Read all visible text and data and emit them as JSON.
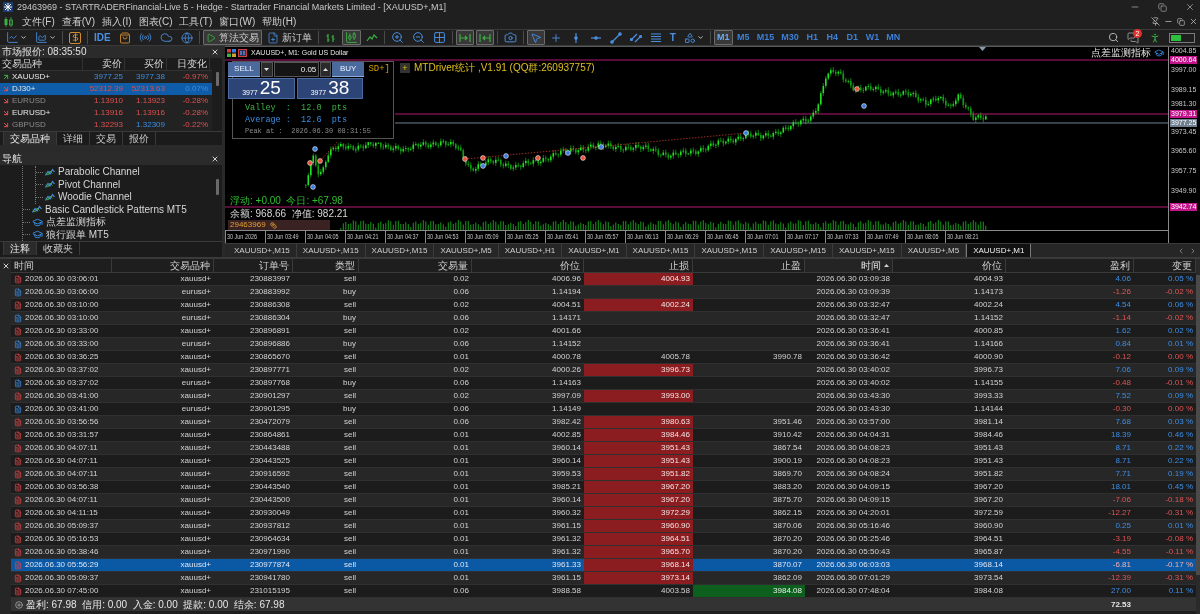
{
  "window": {
    "title": "29463969 - STARTRADERFinancial-Live 5 - Hedge - Startrader Financial Markets Limited - [XAUUSD+,M1]"
  },
  "menu": [
    "文件(F)",
    "查看(V)",
    "插入(I)",
    "图表(C)",
    "工具(T)",
    "窗口(W)",
    "帮助(H)"
  ],
  "toolbar": {
    "groups": [
      [
        {
          "kind": "indicators",
          "pressed": false
        },
        {
          "kind": "templates",
          "pressed": false
        }
      ],
      [
        {
          "kind": "dollar",
          "pressed": false
        }
      ],
      [
        {
          "kind": "ide",
          "label": "IDE",
          "pressed": false
        },
        {
          "kind": "market",
          "pressed": false
        },
        {
          "kind": "signals",
          "pressed": false
        },
        {
          "kind": "cloud",
          "pressed": false
        },
        {
          "kind": "vps",
          "pressed": false
        }
      ],
      [
        {
          "kind": "algo-trading",
          "label": "算法交易",
          "pressed": true
        },
        {
          "kind": "new-order",
          "label": "新订单",
          "pressed": false
        }
      ],
      [
        {
          "kind": "bar-chart",
          "pressed": false
        },
        {
          "kind": "candlestick-chart",
          "pressed": true
        },
        {
          "kind": "line-chart",
          "pressed": false
        }
      ],
      [
        {
          "kind": "zoom-in",
          "pressed": false
        },
        {
          "kind": "zoom-out",
          "pressed": false
        },
        {
          "kind": "tile",
          "pressed": false
        }
      ],
      [
        {
          "kind": "auto-scroll",
          "pressed": true
        },
        {
          "kind": "chart-shift",
          "pressed": true
        }
      ],
      [
        {
          "kind": "screenshot",
          "pressed": false
        }
      ],
      [
        {
          "kind": "cursor",
          "pressed": true
        },
        {
          "kind": "crosshair",
          "pressed": false
        },
        {
          "kind": "vertical-line",
          "pressed": false
        },
        {
          "kind": "horizontal-line",
          "pressed": false
        },
        {
          "kind": "trend-line",
          "pressed": false
        },
        {
          "kind": "channel",
          "pressed": false
        },
        {
          "kind": "fibonacci",
          "pressed": false
        },
        {
          "kind": "text-tool",
          "label": "T",
          "pressed": false
        },
        {
          "kind": "shapes",
          "pressed": false
        }
      ]
    ],
    "timeframes": [
      {
        "label": "M1",
        "selected": true
      },
      {
        "label": "M5",
        "selected": false
      },
      {
        "label": "M15",
        "selected": false
      },
      {
        "label": "M30",
        "selected": false
      },
      {
        "label": "H1",
        "selected": false
      },
      {
        "label": "H4",
        "selected": false
      },
      {
        "label": "D1",
        "selected": false
      },
      {
        "label": "W1",
        "selected": false
      },
      {
        "label": "MN",
        "selected": false
      }
    ],
    "notifications": "2"
  },
  "market_watch": {
    "title": "市场报价: 08:35:50",
    "columns": [
      "交易品种",
      "卖价",
      "买价",
      "日变化"
    ],
    "rows": [
      {
        "symbol": "XAUUSD+",
        "bid": "3977.25",
        "ask": "3977.38",
        "change": "-0.97%",
        "rising": true,
        "bid_up": true,
        "ask_up": true,
        "change_up": false,
        "selected": false,
        "dimmed": false
      },
      {
        "symbol": "DJ30+",
        "bid": "52312.39",
        "ask": "52313.63",
        "change": "0.07%",
        "rising": false,
        "bid_up": false,
        "ask_up": false,
        "change_up": true,
        "selected": true,
        "dimmed": false
      },
      {
        "symbol": "EURUSD",
        "bid": "1.13910",
        "ask": "1.13923",
        "change": "-0.28%",
        "rising": false,
        "bid_up": false,
        "ask_up": false,
        "change_up": false,
        "selected": false,
        "dimmed": true
      },
      {
        "symbol": "EURUSD+",
        "bid": "1.13916",
        "ask": "1.13916",
        "change": "-0.28%",
        "rising": false,
        "bid_up": false,
        "ask_up": false,
        "change_up": false,
        "selected": false,
        "dimmed": false
      },
      {
        "symbol": "GBPUSD",
        "bid": "1.32293",
        "ask": "1.32309",
        "change": "-0.22%",
        "rising": false,
        "bid_up": false,
        "ask_up": true,
        "change_up": false,
        "selected": false,
        "dimmed": true
      }
    ],
    "tabs": [
      {
        "label": "交易品种",
        "selected": true
      },
      {
        "label": "详细",
        "selected": false
      },
      {
        "label": "交易",
        "selected": false
      },
      {
        "label": "报价",
        "selected": false
      }
    ]
  },
  "navigator": {
    "title": "导航",
    "items": [
      {
        "children": [
          {
            "label": "Parabolic Channel",
            "kind": "indicator"
          },
          {
            "label": "Pivot Channel",
            "kind": "indicator"
          },
          {
            "label": "Woodie Channel",
            "kind": "indicator"
          }
        ]
      },
      {
        "label": "Basic Candlestick Patterns MT5",
        "kind": "indicator"
      },
      {
        "label": "点差监测指标",
        "kind": "expert"
      },
      {
        "label": "狼行跟单 MT5",
        "kind": "expert"
      }
    ],
    "tabs": [
      {
        "label": "注释",
        "selected": true
      },
      {
        "label": "收藏夹",
        "selected": false
      }
    ]
  },
  "chart": {
    "title": "XAUUSD+, M1: Gold US Dollar",
    "trade_panel": {
      "sell": {
        "label": "SELL",
        "price_main": "3977",
        "price_pips": "25"
      },
      "buy": {
        "label": "BUY",
        "price_main": "3977",
        "price_pips": "38"
      },
      "volume": "0.05"
    },
    "stats": {
      "title": "SD+]",
      "lines": [
        {
          "kind": "valley",
          "text": "Valley  :  12.0  pts"
        },
        {
          "kind": "average",
          "text": "Average :  12.6  pts"
        },
        {
          "kind": "peak",
          "text": "Peak at :  2026.06.30 08:31:55"
        }
      ]
    },
    "indicator": {
      "button": "+",
      "label": "MTDriver统计 ,V1.91 (QQ群:260937757)"
    },
    "corner_label": "点差监测指标",
    "account": {
      "lines": [
        {
          "kind": "floating",
          "text": "浮动: +0.00  今日: +67.98"
        },
        {
          "kind": "balance",
          "text": "余额: 968.66  净值: 982.21"
        }
      ],
      "badge": "29463969"
    },
    "price_axis": [
      {
        "label": "4004.85",
        "kind": "tick"
      },
      {
        "label": "4000.64",
        "kind": "level"
      },
      {
        "label": "3997.00",
        "kind": "tick"
      },
      {
        "label": "3989.15",
        "kind": "tick"
      },
      {
        "label": "3981.30",
        "kind": "tick"
      },
      {
        "label": "3979.31",
        "kind": "level"
      },
      {
        "label": "3977.25",
        "kind": "bid"
      },
      {
        "label": "3973.45",
        "kind": "tick"
      },
      {
        "label": "3965.60",
        "kind": "tick"
      },
      {
        "label": "3957.75",
        "kind": "tick"
      },
      {
        "label": "3949.90",
        "kind": "tick"
      },
      {
        "label": "3942.74",
        "kind": "level"
      }
    ],
    "time_axis": [
      "30 Jun 2026",
      "30 Jun 03:49",
      "30 Jun 04:05",
      "30 Jun 04:21",
      "30 Jun 04:37",
      "30 Jun 04:53",
      "30 Jun 05:09",
      "30 Jun 05:25",
      "30 Jun 05:41",
      "30 Jun 05:57",
      "30 Jun 06:13",
      "30 Jun 06:29",
      "30 Jun 06:45",
      "30 Jun 07:01",
      "30 Jun 07:17",
      "30 Jun 07:33",
      "30 Jun 07:49",
      "30 Jun 08:05",
      "30 Jun 08:21"
    ]
  },
  "chart_tabs": [
    {
      "label": "XAUUSD+,M15",
      "selected": false
    },
    {
      "label": "XAUUSD+,M15",
      "selected": false
    },
    {
      "label": "XAUUSD+,M15",
      "selected": false
    },
    {
      "label": "XAUUSD+,M5",
      "selected": false
    },
    {
      "label": "XAUUSD+,H1",
      "selected": false
    },
    {
      "label": "XAUUSD+,M1",
      "selected": false
    },
    {
      "label": "XAUUSD+,M15",
      "selected": false
    },
    {
      "label": "XAUUSD+,M15",
      "selected": false
    },
    {
      "label": "XAUUSD+,M15",
      "selected": false
    },
    {
      "label": "XAUUSD+,M15",
      "selected": false
    },
    {
      "label": "XAUUSD+,M5",
      "selected": false
    },
    {
      "label": "XAUUSD+,M1",
      "selected": true
    }
  ],
  "toolbox": {
    "columns": [
      {
        "label": "时间",
        "sorted": false
      },
      {
        "label": "交易品种",
        "sorted": false
      },
      {
        "label": "订单号",
        "sorted": false
      },
      {
        "label": "类型",
        "sorted": false
      },
      {
        "label": "交易量",
        "sorted": false
      },
      {
        "label": "价位",
        "sorted": false
      },
      {
        "label": "止损",
        "sorted": false
      },
      {
        "label": "止盈",
        "sorted": false
      },
      {
        "label": "时间",
        "sorted": true
      },
      {
        "label": "价位",
        "sorted": false
      },
      {
        "label": "盈利",
        "sorted": false
      },
      {
        "label": "变更",
        "sorted": false
      }
    ],
    "rows": [
      {
        "kind": "sell",
        "open_time": "2026.06.30 03:06:01",
        "symbol": "xauusd+",
        "order": "230883997",
        "type": "sell",
        "volume": "0.02",
        "open_price": "4006.96",
        "sl": "4004.93",
        "sl_highlight": true,
        "close_time": "2026.06.30 03:09:38",
        "price": "4004.93",
        "profit": "4.06",
        "change": "0.05 %",
        "profitable": true,
        "selected": false
      },
      {
        "kind": "buy",
        "open_time": "2026.06.30 03:06:00",
        "symbol": "eurusd+",
        "order": "230883992",
        "type": "buy",
        "volume": "0.06",
        "open_price": "1.14194",
        "close_time": "2026.06.30 03:09:39",
        "price": "1.14173",
        "profit": "-1.26",
        "change": "-0.02 %",
        "profitable": false,
        "selected": false
      },
      {
        "kind": "sell",
        "open_time": "2026.06.30 03:10:00",
        "symbol": "xauusd+",
        "order": "230886308",
        "type": "sell",
        "volume": "0.02",
        "open_price": "4004.51",
        "sl": "4002.24",
        "sl_highlight": true,
        "close_time": "2026.06.30 03:32:47",
        "price": "4002.24",
        "profit": "4.54",
        "change": "0.06 %",
        "profitable": true,
        "selected": false
      },
      {
        "kind": "buy",
        "open_time": "2026.06.30 03:10:00",
        "symbol": "eurusd+",
        "order": "230886304",
        "type": "buy",
        "volume": "0.06",
        "open_price": "1.14171",
        "close_time": "2026.06.30 03:32:47",
        "price": "1.14152",
        "profit": "-1.14",
        "change": "-0.02 %",
        "profitable": false,
        "selected": false
      },
      {
        "kind": "sell",
        "open_time": "2026.06.30 03:33:00",
        "symbol": "xauusd+",
        "order": "230896891",
        "type": "sell",
        "volume": "0.02",
        "open_price": "4001.66",
        "close_time": "2026.06.30 03:36:41",
        "price": "4000.85",
        "profit": "1.62",
        "change": "0.02 %",
        "profitable": true,
        "selected": false
      },
      {
        "kind": "buy",
        "open_time": "2026.06.30 03:33:00",
        "symbol": "eurusd+",
        "order": "230896886",
        "type": "buy",
        "volume": "0.06",
        "open_price": "1.14152",
        "close_time": "2026.06.30 03:36:41",
        "price": "1.14166",
        "profit": "0.84",
        "change": "0.01 %",
        "profitable": true,
        "selected": false
      },
      {
        "kind": "sell",
        "open_time": "2026.06.30 03:36:25",
        "symbol": "xauusd+",
        "order": "230865670",
        "type": "sell",
        "volume": "0.01",
        "open_price": "4000.78",
        "sl": "4005.78",
        "sl_highlight": false,
        "tp": "3990.78",
        "tp_highlight": false,
        "close_time": "2026.06.30 03:36:42",
        "price": "4000.90",
        "profit": "-0.12",
        "change": "0.00 %",
        "profitable": false,
        "selected": false
      },
      {
        "kind": "sell",
        "open_time": "2026.06.30 03:37:02",
        "symbol": "xauusd+",
        "order": "230897771",
        "type": "sell",
        "volume": "0.02",
        "open_price": "4000.26",
        "sl": "3996.73",
        "sl_highlight": true,
        "close_time": "2026.06.30 03:40:02",
        "price": "3996.73",
        "profit": "7.06",
        "change": "0.09 %",
        "profitable": true,
        "selected": false
      },
      {
        "kind": "buy",
        "open_time": "2026.06.30 03:37:02",
        "symbol": "eurusd+",
        "order": "230897768",
        "type": "buy",
        "volume": "0.06",
        "open_price": "1.14163",
        "close_time": "2026.06.30 03:40:02",
        "price": "1.14155",
        "profit": "-0.48",
        "change": "-0.01 %",
        "profitable": false,
        "selected": false
      },
      {
        "kind": "sell",
        "open_time": "2026.06.30 03:41:00",
        "symbol": "xauusd+",
        "order": "230901297",
        "type": "sell",
        "volume": "0.02",
        "open_price": "3997.09",
        "sl": "3993.00",
        "sl_highlight": true,
        "close_time": "2026.06.30 03:43:30",
        "price": "3993.33",
        "profit": "7.52",
        "change": "0.09 %",
        "profitable": true,
        "selected": false
      },
      {
        "kind": "buy",
        "open_time": "2026.06.30 03:41:00",
        "symbol": "eurusd+",
        "order": "230901295",
        "type": "buy",
        "volume": "0.06",
        "open_price": "1.14149",
        "close_time": "2026.06.30 03:43:30",
        "price": "1.14144",
        "profit": "-0.30",
        "change": "0.00 %",
        "profitable": false,
        "selected": false
      },
      {
        "kind": "sell",
        "open_time": "2026.06.30 03:56:56",
        "symbol": "xauusd+",
        "order": "230472079",
        "type": "sell",
        "volume": "0.06",
        "open_price": "3982.42",
        "sl": "3980.63",
        "sl_highlight": true,
        "tp": "3951.46",
        "tp_highlight": false,
        "close_time": "2026.06.30 03:57:00",
        "price": "3981.14",
        "profit": "7.68",
        "change": "0.03 %",
        "profitable": true,
        "selected": false
      },
      {
        "kind": "sell",
        "open_time": "2026.06.30 03:31:57",
        "symbol": "xauusd+",
        "order": "230864861",
        "type": "sell",
        "volume": "0.01",
        "open_price": "4002.85",
        "sl": "3984.46",
        "sl_highlight": true,
        "tp": "3910.42",
        "tp_highlight": false,
        "close_time": "2026.06.30 04:04:31",
        "price": "3984.46",
        "profit": "18.39",
        "change": "0.46 %",
        "profitable": true,
        "selected": false
      },
      {
        "kind": "sell",
        "open_time": "2026.06.30 04:07:11",
        "symbol": "xauusd+",
        "order": "230443488",
        "type": "sell",
        "volume": "0.01",
        "open_price": "3960.14",
        "sl": "3951.43",
        "sl_highlight": true,
        "tp": "3867.54",
        "tp_highlight": false,
        "close_time": "2026.06.30 04:08:23",
        "price": "3951.43",
        "profit": "8.71",
        "change": "0.22 %",
        "profitable": true,
        "selected": false
      },
      {
        "kind": "sell",
        "open_time": "2026.06.30 04:07:11",
        "symbol": "xauusd+",
        "order": "230443525",
        "type": "sell",
        "volume": "0.01",
        "open_price": "3960.14",
        "sl": "3951.43",
        "sl_highlight": true,
        "tp": "3900.19",
        "tp_highlight": false,
        "close_time": "2026.06.30 04:08:23",
        "price": "3951.43",
        "profit": "8.71",
        "change": "0.22 %",
        "profitable": true,
        "selected": false
      },
      {
        "kind": "sell",
        "open_time": "2026.06.30 04:07:11",
        "symbol": "xauusd+",
        "order": "230916592",
        "type": "sell",
        "volume": "0.01",
        "open_price": "3959.53",
        "sl": "3951.82",
        "sl_highlight": true,
        "tp": "3869.70",
        "tp_highlight": false,
        "close_time": "2026.06.30 04:08:24",
        "price": "3951.82",
        "profit": "7.71",
        "change": "0.19 %",
        "profitable": true,
        "selected": false
      },
      {
        "kind": "sell",
        "open_time": "2026.06.30 03:56:38",
        "symbol": "xauusd+",
        "order": "230443540",
        "type": "sell",
        "volume": "0.01",
        "open_price": "3985.21",
        "sl": "3967.20",
        "sl_highlight": true,
        "tp": "3883.20",
        "tp_highlight": false,
        "close_time": "2026.06.30 04:09:15",
        "price": "3967.20",
        "profit": "18.01",
        "change": "0.45 %",
        "profitable": true,
        "selected": false
      },
      {
        "kind": "sell",
        "open_time": "2026.06.30 04:07:11",
        "symbol": "xauusd+",
        "order": "230443500",
        "type": "sell",
        "volume": "0.01",
        "open_price": "3960.14",
        "sl": "3967.20",
        "sl_highlight": true,
        "tp": "3875.70",
        "tp_highlight": false,
        "close_time": "2026.06.30 04:09:15",
        "price": "3967.20",
        "profit": "-7.06",
        "change": "-0.18 %",
        "profitable": false,
        "selected": false
      },
      {
        "kind": "sell",
        "open_time": "2026.06.30 04:11:15",
        "symbol": "xauusd+",
        "order": "230930049",
        "type": "sell",
        "volume": "0.01",
        "open_price": "3960.32",
        "sl": "3972.29",
        "sl_highlight": true,
        "tp": "3862.15",
        "tp_highlight": false,
        "close_time": "2026.06.30 04:20:01",
        "price": "3972.59",
        "profit": "-12.27",
        "change": "-0.31 %",
        "profitable": false,
        "selected": false
      },
      {
        "kind": "sell",
        "open_time": "2026.06.30 05:09:37",
        "symbol": "xauusd+",
        "order": "230937812",
        "type": "sell",
        "volume": "0.01",
        "open_price": "3961.15",
        "sl": "3960.90",
        "sl_highlight": true,
        "tp": "3870.06",
        "tp_highlight": false,
        "close_time": "2026.06.30 05:16:46",
        "price": "3960.90",
        "profit": "0.25",
        "change": "0.01 %",
        "profitable": true,
        "selected": false
      },
      {
        "kind": "sell",
        "open_time": "2026.06.30 05:16:53",
        "symbol": "xauusd+",
        "order": "230964634",
        "type": "sell",
        "volume": "0.01",
        "open_price": "3961.32",
        "sl": "3964.51",
        "sl_highlight": true,
        "tp": "3870.20",
        "tp_highlight": false,
        "close_time": "2026.06.30 05:25:46",
        "price": "3964.51",
        "profit": "-3.19",
        "change": "-0.08 %",
        "profitable": false,
        "selected": false
      },
      {
        "kind": "sell",
        "open_time": "2026.06.30 05:38:46",
        "symbol": "xauusd+",
        "order": "230971990",
        "type": "sell",
        "volume": "0.01",
        "open_price": "3961.32",
        "sl": "3965.70",
        "sl_highlight": true,
        "tp": "3870.20",
        "tp_highlight": false,
        "close_time": "2026.06.30 05:50:43",
        "price": "3965.87",
        "profit": "-4.55",
        "change": "-0.11 %",
        "profitable": false,
        "selected": false
      },
      {
        "kind": "sell",
        "open_time": "2026.06.30 05:56:29",
        "symbol": "xauusd+",
        "order": "230977874",
        "type": "sell",
        "volume": "0.01",
        "open_price": "3961.33",
        "sl": "3968.14",
        "sl_highlight": true,
        "tp": "3870.07",
        "tp_highlight": false,
        "close_time": "2026.06.30 06:03:03",
        "price": "3968.14",
        "profit": "-6.81",
        "change": "-0.17 %",
        "profitable": false,
        "selected": true
      },
      {
        "kind": "sell",
        "open_time": "2026.06.30 05:09:37",
        "symbol": "xauusd+",
        "order": "230941780",
        "type": "sell",
        "volume": "0.01",
        "open_price": "3961.15",
        "sl": "3973.14",
        "sl_highlight": true,
        "tp": "3862.09",
        "tp_highlight": false,
        "close_time": "2026.06.30 07:01:29",
        "price": "3973.54",
        "profit": "-12.39",
        "change": "-0.31 %",
        "profitable": false,
        "selected": false
      },
      {
        "kind": "sell",
        "open_time": "2026.06.30 07:45:00",
        "symbol": "xauusd+",
        "order": "231015195",
        "type": "sell",
        "volume": "0.06",
        "open_price": "3988.58",
        "sl": "4003.58",
        "sl_highlight": false,
        "tp": "3984.08",
        "tp_highlight": true,
        "close_time": "2026.06.30 07:48:04",
        "price": "3984.08",
        "profit": "27.00",
        "change": "0.11 %",
        "profitable": true,
        "selected": false
      }
    ],
    "footer": {
      "summary": "盈利: 67.98  信用: 0.00  入金: 0.00  提款: 0.00  结余: 67.98",
      "total": "72.53"
    }
  }
}
